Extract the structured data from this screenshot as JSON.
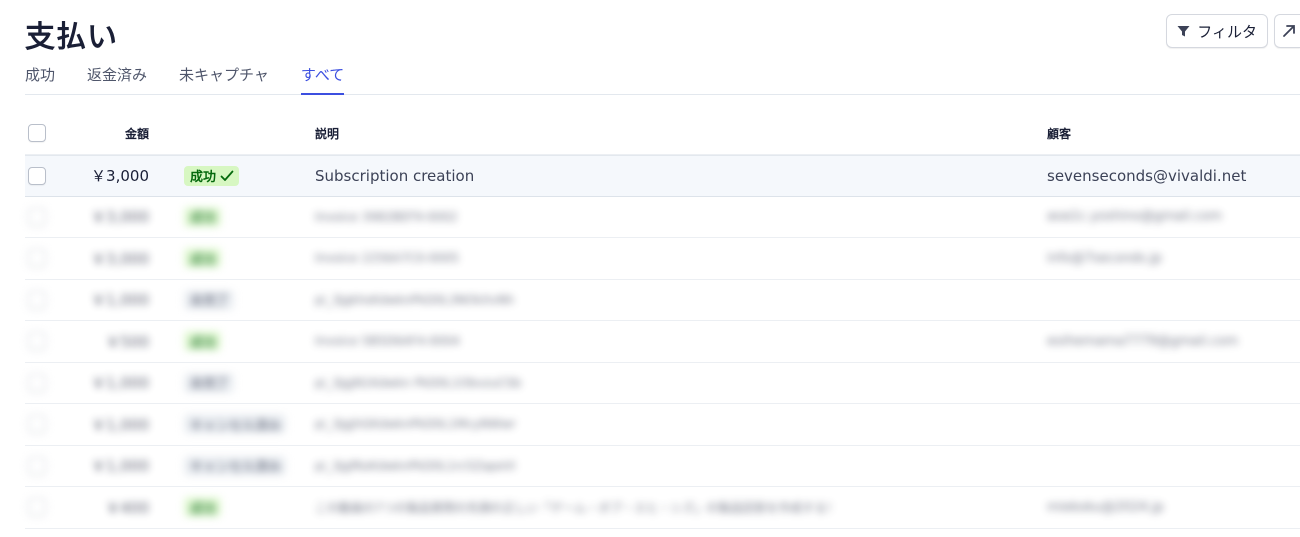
{
  "page": {
    "title": "支払い"
  },
  "toolbar": {
    "filter_label": "フィルタ"
  },
  "tabs": [
    {
      "label": "成功",
      "active": false
    },
    {
      "label": "返金済み",
      "active": false
    },
    {
      "label": "未キャプチャ",
      "active": false
    },
    {
      "label": "すべて",
      "active": true
    }
  ],
  "table": {
    "headers": {
      "amount": "金額",
      "status": "",
      "description": "説明",
      "customer": "顧客"
    },
    "highlighted_row": {
      "amount": "￥3,000",
      "status": "成功",
      "description": "Subscription creation",
      "customer": "sevenseconds@vivaldi.net"
    },
    "blurred_rows": [
      {
        "amount": "￥3,000",
        "status": "成功",
        "status_color": "green",
        "description": "Invoice 3982BEF9-0002",
        "customer": "aoa1c.yoshino@gmail.com"
      },
      {
        "amount": "￥3,000",
        "status": "成功",
        "status_color": "green",
        "description": "Invoice 2256A7C0-0005",
        "customer": "info@7seconds.jp"
      },
      {
        "amount": "￥1,000",
        "status": "未完了",
        "status_color": "gray",
        "description": "pi_3JgkhsKdwknPkD0L3NOkXvNh",
        "customer": ""
      },
      {
        "amount": "￥500",
        "status": "成功",
        "status_color": "green",
        "description": "Invoice 5B5D6AF4-0004",
        "customer": "eoihemama7779@gmail.com"
      },
      {
        "amount": "￥1,000",
        "status": "未完了",
        "status_color": "gray",
        "description": "pi_3JgjN1Kdwkn PkD0L1ObvzuCSb",
        "customer": ""
      },
      {
        "amount": "￥1,000",
        "status": "キャンセル済み",
        "status_color": "gray",
        "description": "pi_3JgjhGKdwknPkD0L1McyNWwr",
        "customer": ""
      },
      {
        "amount": "￥1,000",
        "status": "キャンセル済み",
        "status_color": "gray",
        "description": "pi_3JgfKoKdwknPkD0L1rc5ZapeVi",
        "customer": ""
      },
      {
        "amount": "￥400",
        "status": "成功",
        "status_color": "green",
        "description": "この動画の7つの製品質問の先頭の正しい「ゲーム・ボブ・エヒ・シズ」の製品回答を作成する！",
        "customer": "miekoku@2024.jp"
      }
    ]
  },
  "colors": {
    "accent": "#3c4fe0",
    "success_bg": "#d7f7c2",
    "success_fg": "#05690d"
  }
}
